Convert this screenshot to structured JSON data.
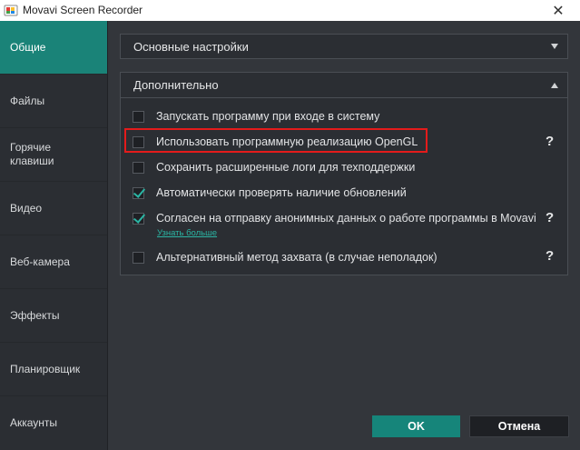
{
  "window": {
    "title": "Movavi Screen Recorder",
    "close_symbol": "✕"
  },
  "sidebar": {
    "items": [
      {
        "label": "Общие",
        "active": true
      },
      {
        "label": "Файлы",
        "active": false
      },
      {
        "label": "Горячие клавиши",
        "active": false
      },
      {
        "label": "Видео",
        "active": false
      },
      {
        "label": "Веб-камера",
        "active": false
      },
      {
        "label": "Эффекты",
        "active": false
      },
      {
        "label": "Планировщик",
        "active": false
      },
      {
        "label": "Аккаунты",
        "active": false
      }
    ]
  },
  "basic_section": {
    "title": "Основные настройки",
    "icon": "chevron-down-icon",
    "expanded": false
  },
  "advanced_section": {
    "title": "Дополнительно",
    "icon": "chevron-up-icon",
    "expanded": true,
    "options": [
      {
        "label": "Запускать программу при входе в систему",
        "checked": false,
        "help": false
      },
      {
        "label": "Использовать программную реализацию OpenGL",
        "checked": false,
        "help": true,
        "highlighted": true
      },
      {
        "label": "Сохранить расширенные логи для техподдержки",
        "checked": false,
        "help": false
      },
      {
        "label": "Автоматически проверять наличие обновлений",
        "checked": true,
        "help": false
      },
      {
        "label": "Согласен на отправку анонимных данных о работе программы в Movavi",
        "checked": true,
        "help": true
      },
      {
        "label": "Альтернативный метод захвата (в случае неполадок)",
        "checked": false,
        "help": true
      }
    ],
    "learn_more_link": "Узнать больше",
    "help_symbol": "?"
  },
  "buttons": {
    "ok": "OK",
    "cancel": "Отмена"
  },
  "colors": {
    "accent": "#1a8378",
    "checkmark": "#2bb5a4",
    "highlight_border": "#e41b1b",
    "background": "#2b2e33"
  }
}
